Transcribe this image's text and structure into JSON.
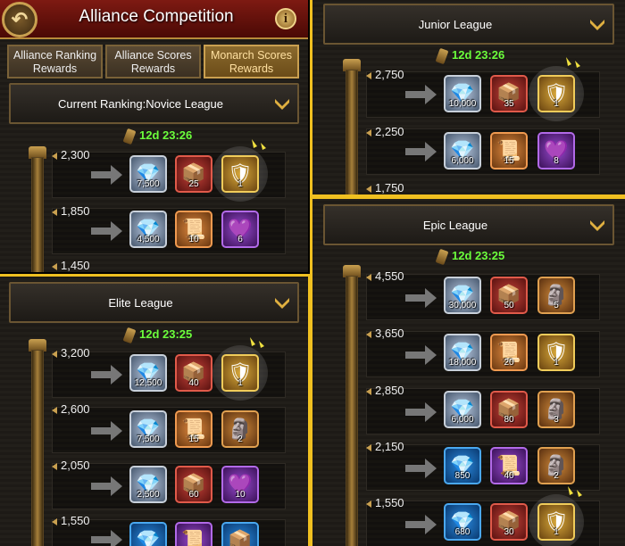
{
  "main": {
    "title": "Alliance Competition",
    "back_icon": "back-arrow-icon",
    "info_icon": "info-icon",
    "info_label": "i",
    "tabs": [
      {
        "label": "Alliance Ranking Rewards",
        "active": false
      },
      {
        "label": "Alliance Scores Rewards",
        "active": false
      },
      {
        "label": "Monarch Scores Rewards",
        "active": true
      }
    ],
    "league_label": "Current Ranking:Novice League",
    "timer": "12d 23:26",
    "scores": [
      "2,300",
      "1,850",
      "1,450"
    ],
    "rewards": [
      [
        {
          "type": "gem",
          "qty": "7,500"
        },
        {
          "type": "chest",
          "qty": "25"
        },
        {
          "type": "gold",
          "qty": "1"
        }
      ],
      [
        {
          "type": "gem",
          "qty": "4,500"
        },
        {
          "type": "scroll",
          "qty": "10"
        },
        {
          "type": "purple",
          "qty": "6"
        }
      ]
    ]
  },
  "junior": {
    "league_label": "Junior League",
    "timer": "12d 23:26",
    "scores": [
      "2,750",
      "2,250",
      "1,750"
    ],
    "rewards": [
      [
        {
          "type": "gem",
          "qty": "10,000"
        },
        {
          "type": "chest",
          "qty": "35"
        },
        {
          "type": "gold",
          "qty": "1"
        }
      ],
      [
        {
          "type": "gem",
          "qty": "6,000"
        },
        {
          "type": "scroll",
          "qty": "15"
        },
        {
          "type": "purple",
          "qty": "8"
        }
      ]
    ]
  },
  "elite": {
    "league_label": "Elite League",
    "timer": "12d 23:25",
    "scores": [
      "3,200",
      "2,600",
      "2,050",
      "1,550"
    ],
    "rewards": [
      [
        {
          "type": "gem",
          "qty": "12,500"
        },
        {
          "type": "chest",
          "qty": "40"
        },
        {
          "type": "gold",
          "qty": "1"
        }
      ],
      [
        {
          "type": "gem",
          "qty": "7,500"
        },
        {
          "type": "scroll",
          "qty": "15"
        },
        {
          "type": "statue",
          "qty": "2"
        }
      ],
      [
        {
          "type": "gem",
          "qty": "2,500"
        },
        {
          "type": "chest",
          "qty": "60"
        },
        {
          "type": "purple",
          "qty": "10"
        }
      ]
    ]
  },
  "epic": {
    "league_label": "Epic League",
    "timer": "12d 23:25",
    "scores": [
      "4,550",
      "3,650",
      "2,850",
      "2,150",
      "1,550"
    ],
    "rewards": [
      [
        {
          "type": "gem",
          "qty": "30,000"
        },
        {
          "type": "chest",
          "qty": "50"
        },
        {
          "type": "statue",
          "qty": "5"
        }
      ],
      [
        {
          "type": "gem",
          "qty": "18,000"
        },
        {
          "type": "scroll",
          "qty": "20"
        },
        {
          "type": "gold",
          "qty": "1"
        }
      ],
      [
        {
          "type": "gem",
          "qty": "6,000"
        },
        {
          "type": "chest",
          "qty": "80"
        },
        {
          "type": "statue",
          "qty": "3"
        }
      ],
      [
        {
          "type": "blue",
          "qty": "850"
        },
        {
          "type": "purple",
          "qty": "40"
        },
        {
          "type": "statue",
          "qty": "2"
        }
      ],
      [
        {
          "type": "blue",
          "qty": "680"
        },
        {
          "type": "chest",
          "qty": "30"
        },
        {
          "type": "gold",
          "qty": "1"
        }
      ]
    ]
  },
  "colors": {
    "accent": "#f0c020",
    "timer": "#6cff3c",
    "title_bg": "#7e1a12"
  }
}
